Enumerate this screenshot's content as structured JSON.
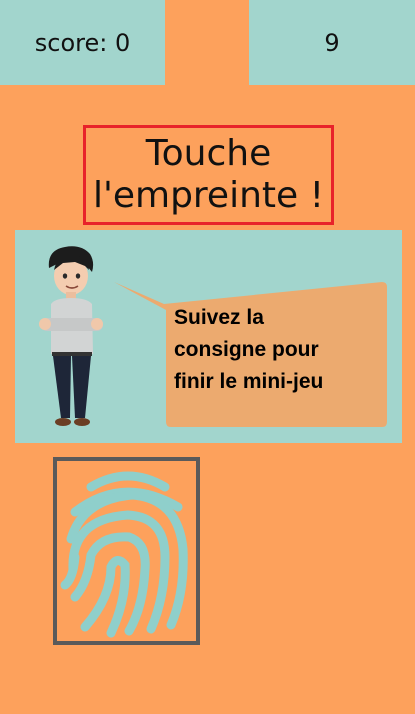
{
  "hud": {
    "score_text": "score: 0",
    "timer_value": "9"
  },
  "instruction": {
    "line1": "Touche",
    "line2": "l'empreinte !"
  },
  "dialog": {
    "line1": "Suivez la",
    "line2": "consigne pour",
    "line3": "finir le mini-jeu"
  },
  "colors": {
    "background": "#FDA15C",
    "panel": "#A2D5CD",
    "bubble": "#ECAA6F",
    "title_border": "#E8232A",
    "fingerprint_frame": "#5A5A5A",
    "fingerprint_ridges": "#8FCFCB"
  },
  "icons": {
    "character": "avatar-character-icon",
    "target": "fingerprint-icon"
  }
}
